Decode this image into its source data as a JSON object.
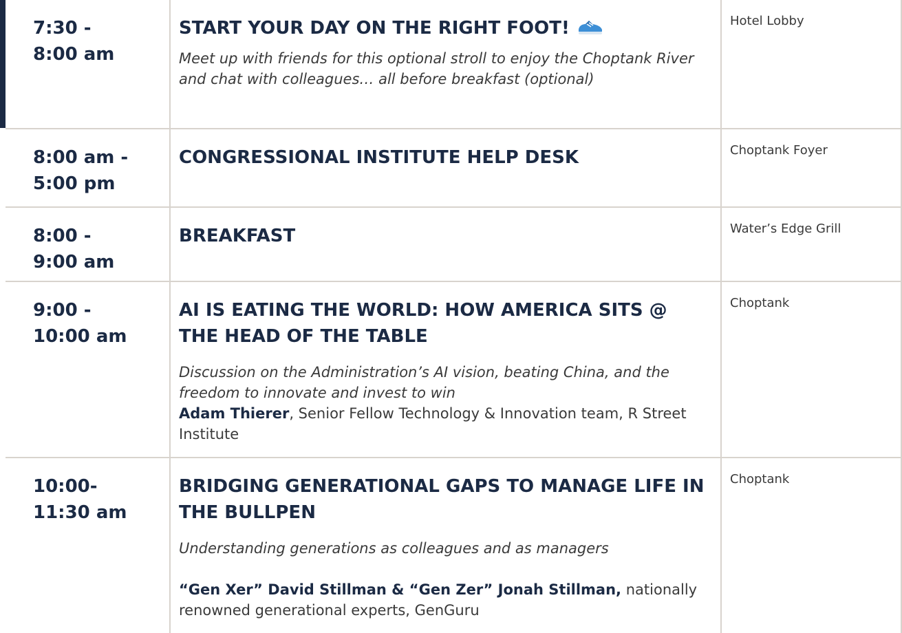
{
  "agenda": [
    {
      "time_line1": "7:30 -",
      "time_line2": "8:00 am",
      "title": "START YOUR DAY ON THE RIGHT FOOT!",
      "title_icon": "shoe-icon",
      "description": "Meet up with friends for this optional stroll to enjoy the Choptank River and chat with colleagues… all before breakfast (optional)",
      "location": "Hotel Lobby"
    },
    {
      "time_line1": "8:00 am -",
      "time_line2": "5:00 pm",
      "title": "CONGRESSIONAL INSTITUTE HELP DESK",
      "location": "Choptank Foyer"
    },
    {
      "time_line1": "8:00 -",
      "time_line2": "9:00 am",
      "title": "BREAKFAST",
      "location": "Water’s Edge Grill"
    },
    {
      "time_line1": "9:00 -",
      "time_line2": "10:00 am",
      "title": "AI IS EATING THE WORLD:  HOW AMERICA SITS @ THE HEAD OF THE TABLE",
      "description": "Discussion on the Administration’s AI vision, beating China, and the freedom to innovate and invest to win",
      "speaker_name": "Adam Thierer",
      "speaker_details": ", Senior Fellow Technology & Innovation team, R Street Institute",
      "location": "Choptank"
    },
    {
      "time_line1": "10:00-",
      "time_line2": "11:30 am",
      "title": "BRIDGING GENERATIONAL GAPS TO MANAGE LIFE IN THE BULLPEN",
      "description": "Understanding generations as colleagues and as managers",
      "speaker_name": "“Gen Xer” David Stillman & “Gen Zer” Jonah Stillman,",
      "speaker_details": " nationally renowned generational experts, GenGuru",
      "location": "Choptank"
    }
  ],
  "colors": {
    "navy": "#1b2a44",
    "body_text": "#3a3a3a",
    "grid": "#d8d3cd",
    "shoe_blue": "#3d8fd6"
  }
}
